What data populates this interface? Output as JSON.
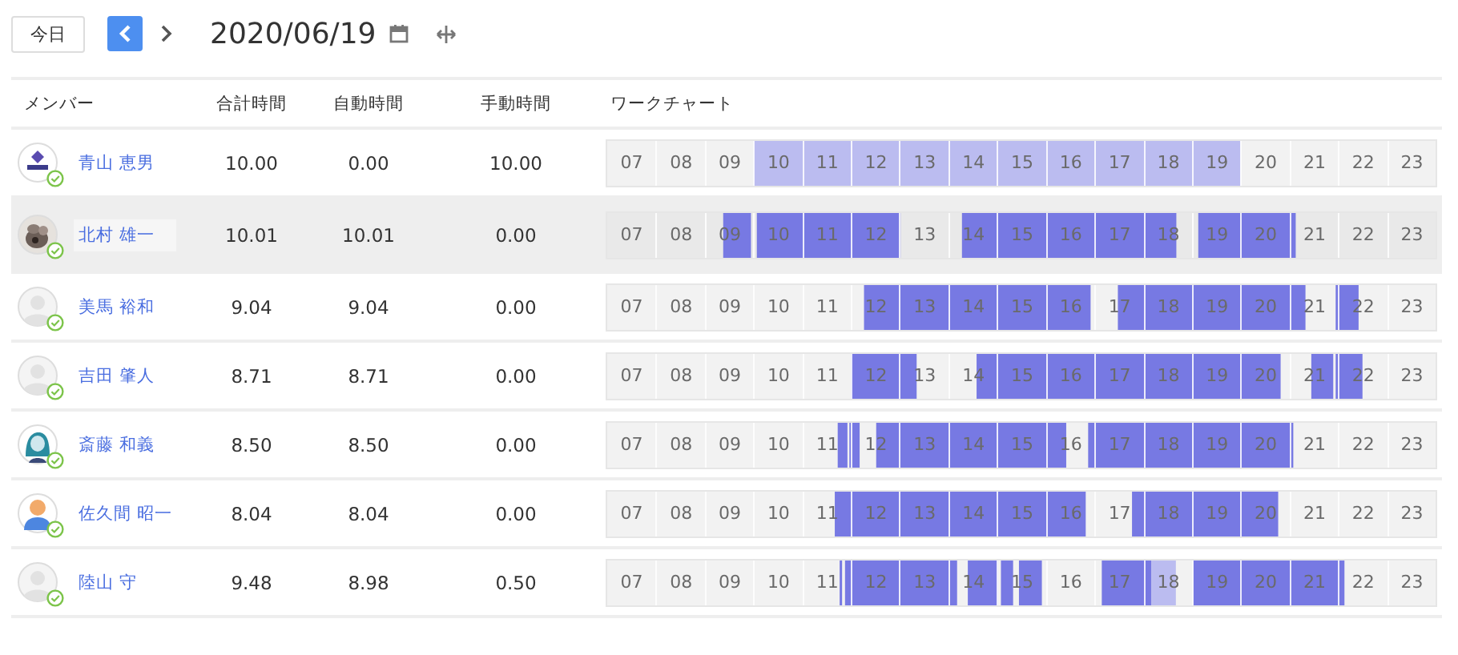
{
  "toolbar": {
    "today_button": "今日",
    "date": "2020/06/19"
  },
  "columns": [
    "メンバー",
    "合計時間",
    "自動時間",
    "手動時間",
    "ワークチャート"
  ],
  "rows": [
    {
      "name": "青山 恵男",
      "avatar": {
        "kind": "logo"
      },
      "selected": false,
      "total": "10.00",
      "auto": "0.00",
      "manual": "10.00",
      "hours": [
        "07",
        "08",
        "09",
        "10",
        "11",
        "12",
        "13",
        "14",
        "15",
        "16",
        "17",
        "18",
        "19",
        "20",
        "21",
        "22",
        "23"
      ]
    },
    {
      "name": "北村 雄一",
      "selected": true,
      "total": "10.01",
      "auto": "10.01",
      "manual": "0.00",
      "hours": [
        "07",
        "08",
        "09",
        "10",
        "11",
        "12",
        "13",
        "14",
        "15",
        "16",
        "17",
        "18",
        "19",
        "20",
        "21",
        "22",
        "23"
      ]
    },
    {
      "name": "美馬 裕和",
      "avatar": {
        "kind": "blank"
      },
      "selected": false,
      "total": "9.04",
      "auto": "9.04",
      "manual": "0.00",
      "hours": [
        "07",
        "08",
        "09",
        "10",
        "11",
        "12",
        "13",
        "14",
        "15",
        "16",
        "17",
        "18",
        "19",
        "20",
        "21",
        "22",
        "23"
      ]
    },
    {
      "name": "吉田 肇人",
      "avatar": {
        "kind": "blank"
      },
      "selected": false,
      "total": "8.71",
      "auto": "8.71",
      "manual": "0.00",
      "hours": [
        "07",
        "08",
        "09",
        "10",
        "11",
        "12",
        "13",
        "14",
        "15",
        "16",
        "17",
        "18",
        "19",
        "20",
        "21",
        "22",
        "23"
      ]
    },
    {
      "name": "斎藤 和義",
      "avatar": {
        "kind": "character"
      },
      "selected": false,
      "total": "8.50",
      "auto": "8.50",
      "manual": "0.00",
      "hours": [
        "07",
        "08",
        "09",
        "10",
        "11",
        "12",
        "13",
        "14",
        "15",
        "16",
        "17",
        "18",
        "19",
        "20",
        "21",
        "22",
        "23"
      ]
    },
    {
      "name": "佐久間 昭一",
      "avatar": {
        "kind": "person"
      },
      "selected": false,
      "total": "8.04",
      "auto": "8.04",
      "manual": "0.00",
      "hours": [
        "07",
        "08",
        "09",
        "10",
        "11",
        "12",
        "13",
        "14",
        "15",
        "16",
        "17",
        "18",
        "19",
        "20",
        "21",
        "22",
        "23"
      ]
    },
    {
      "name": "陸山 守",
      "avatar": {
        "kind": "blank"
      },
      "selected": false,
      "total": "9.48",
      "auto": "8.98",
      "manual": "0.50",
      "hours": [
        "07",
        "08",
        "09",
        "10",
        "11",
        "12",
        "13",
        "14",
        "15",
        "16",
        "17",
        "18",
        "19",
        "20",
        "21",
        "22",
        "23"
      ]
    }
  ]
}
